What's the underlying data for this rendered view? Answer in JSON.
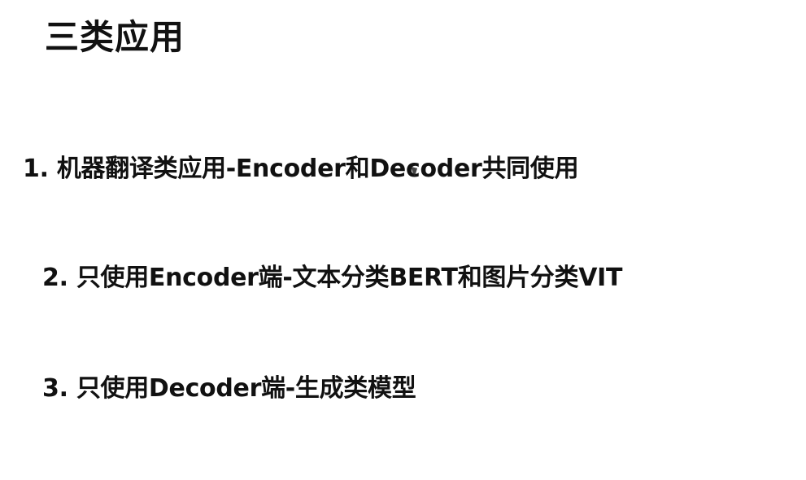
{
  "slide": {
    "title": "三类应用",
    "items": [
      {
        "text": "1. 机器翻译类应用-Encoder和Decoder共同使用"
      },
      {
        "text": "2. 只使用Encoder端-文本分类BERT和图片分类VIT"
      },
      {
        "text": "3. 只使用Decoder端-生成类模型"
      }
    ]
  }
}
